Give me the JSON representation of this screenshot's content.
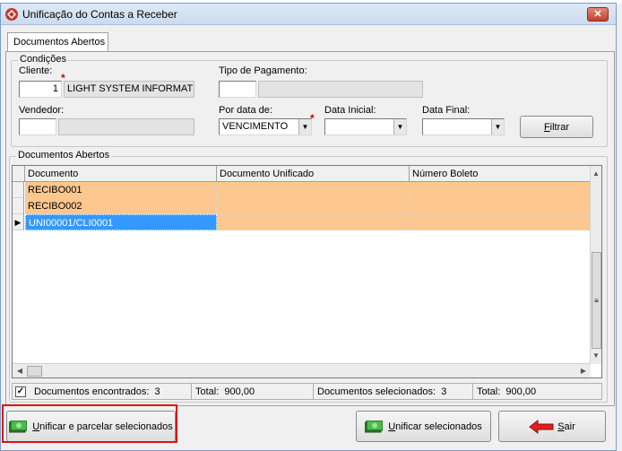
{
  "window": {
    "title": "Unificação do Contas a Receber",
    "close_glyph": "✕"
  },
  "tab": {
    "label": "Documentos Abertos"
  },
  "conditions": {
    "legend": "Condições",
    "cliente": {
      "label": "Cliente:",
      "code": "1",
      "name": "LIGHT SYSTEM INFORMATI"
    },
    "tipo_pagamento": {
      "label": "Tipo de Pagamento:",
      "code": "",
      "name": ""
    },
    "vendedor": {
      "label": "Vendedor:",
      "code": "",
      "name": ""
    },
    "por_data": {
      "label": "Por data de:",
      "value": "VENCIMENTO"
    },
    "data_inicial": {
      "label": "Data Inicial:",
      "value": ""
    },
    "data_final": {
      "label": "Data Final:",
      "value": ""
    },
    "filtrar_first": "F",
    "filtrar_rest": "iltrar",
    "required_mark": "*"
  },
  "documents": {
    "legend": "Documentos Abertos",
    "columns": [
      "Documento",
      "Documento Unificado",
      "Número Boleto"
    ],
    "rows": [
      {
        "documento": "RECIBO001",
        "unificado": "",
        "boleto": ""
      },
      {
        "documento": "RECIBO002",
        "unificado": "",
        "boleto": ""
      },
      {
        "documento": "UNI00001/CLI0001",
        "unificado": "",
        "boleto": ""
      }
    ],
    "current_row_marker": "▶"
  },
  "summary": {
    "check": "✓",
    "encontrados_label": "Documentos encontrados:",
    "encontrados_value": "3",
    "total_label": "Total:",
    "total_value": "900,00",
    "selecionados_label": "Documentos selecionados:",
    "selecionados_value": "3",
    "total_sel_label": "Total:",
    "total_sel_value": "900,00"
  },
  "actions": {
    "unificar_parcelar_first": "U",
    "unificar_parcelar_rest": "nificar e parcelar selecionados",
    "unificar_sel_first": "U",
    "unificar_sel_rest": "nificar selecionados",
    "sair_first": "S",
    "sair_rest": "air"
  },
  "colors": {
    "row_highlight": "#fcc890",
    "selection": "#3399ff",
    "callout": "#e01010"
  },
  "icons": {
    "app": "cash-register-icon",
    "money": "money-stack-icon",
    "exit": "red-left-arrow-icon"
  }
}
